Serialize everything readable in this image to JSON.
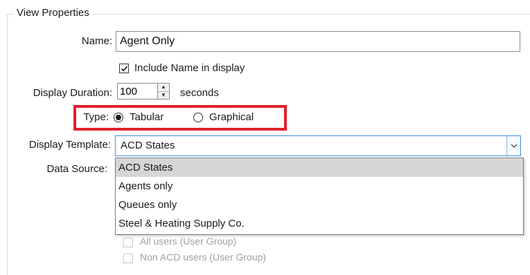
{
  "group": {
    "legend": "View Properties"
  },
  "name_field": {
    "label": "Name:",
    "value": "Agent Only",
    "include_label": "Include Name in display",
    "include_checked": true
  },
  "duration": {
    "label": "Display Duration:",
    "value": "100",
    "unit": "seconds"
  },
  "type": {
    "label": "Type:",
    "options": [
      "Tabular",
      "Graphical"
    ],
    "selected": "Tabular"
  },
  "template": {
    "label": "Display Template:",
    "value": "ACD States",
    "options": [
      "ACD States",
      "Agents only",
      "Queues only",
      "Steel & Heating Supply Co."
    ],
    "highlighted": "ACD States"
  },
  "data_source": {
    "label": "Data Source:",
    "items": [
      {
        "label": "All users (User Group)",
        "checked": false,
        "enabled": false
      },
      {
        "label": "Non ACD users (User Group)",
        "checked": false,
        "enabled": false
      }
    ]
  },
  "colors": {
    "highlight_border": "#e0202a",
    "focus_border": "#3c8ee0",
    "selected_row": "#d6d6d6"
  }
}
